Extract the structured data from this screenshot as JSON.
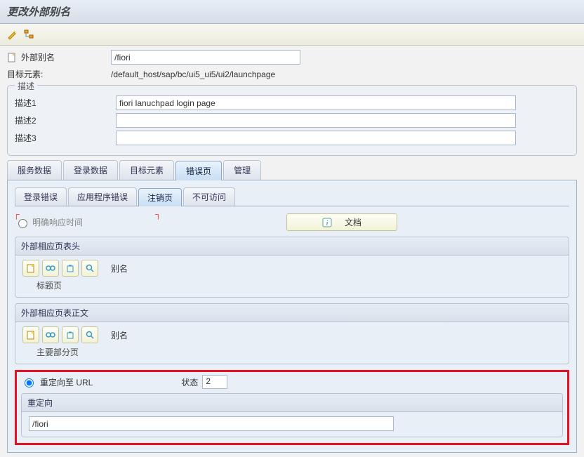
{
  "title": "更改外部别名",
  "toolbar": {
    "icon1": "wand-icon",
    "icon2": "tree-icon"
  },
  "fields": {
    "alias_label": "外部别名",
    "alias_value": "/fiori",
    "target_label": "目标元素:",
    "target_value": "/default_host/sap/bc/ui5_ui5/ui2/launchpage"
  },
  "desc_group": {
    "title": "描述",
    "d1_label": "描述1",
    "d1_value": "fiori lanuchpad login page",
    "d2_label": "描述2",
    "d2_value": "",
    "d3_label": "描述3",
    "d3_value": ""
  },
  "main_tabs": [
    "服务数据",
    "登录数据",
    "目标元素",
    "错误页",
    "管理"
  ],
  "main_tab_active": 3,
  "inner_tabs": [
    "登录错误",
    "应用程序错误",
    "注销页",
    "不可访问"
  ],
  "inner_tab_active": 2,
  "option1": {
    "label": "明确响应时间",
    "doc_btn": "文档"
  },
  "box1": {
    "header": "外部相应页表头",
    "alias_label": "别名",
    "alias_value": "",
    "sub": "标题页"
  },
  "box2": {
    "header": "外部相应页表正文",
    "alias_label": "别名",
    "alias_value": "",
    "sub": "主要部分页"
  },
  "redirect": {
    "label": "重定向至 URL",
    "status_label": "状态",
    "status_value": "2",
    "header": "重定向",
    "url": "/fiori"
  },
  "icons": {
    "new": "new-icon",
    "glasses": "display-icon",
    "trash": "delete-icon",
    "search": "find-icon",
    "info": "info-icon",
    "page": "page-icon"
  }
}
